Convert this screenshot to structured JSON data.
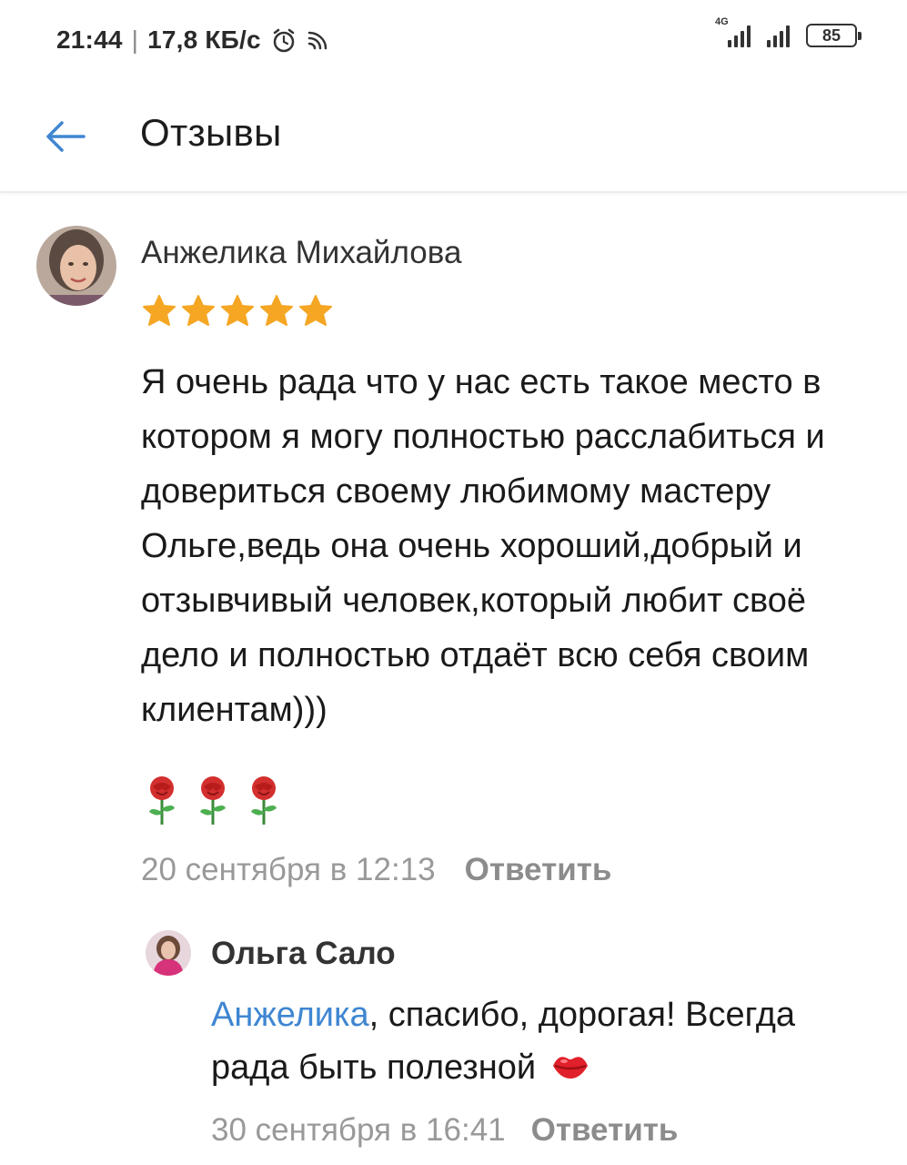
{
  "status_bar": {
    "time": "21:44",
    "speed": "17,8 КБ/с",
    "network_tag": "4G",
    "battery": "85",
    "icons": [
      "alarm-icon",
      "wifi-icon",
      "signal-icon",
      "battery-icon"
    ]
  },
  "app_bar": {
    "title": "Отзывы",
    "back_icon": "arrow-left-icon"
  },
  "review": {
    "author": "Анжелика Михайлова",
    "rating": 5,
    "rating_max": 5,
    "text": "Я очень рада что у нас есть такое место в котором я могу полностью расслабиться и довериться своему любимому мастеру Ольге,ведь она очень хороший,добрый и отзывчивый человек,который любит своё дело и полностью отдаёт всю себя своим клиентам)))",
    "emojis": [
      "rose-icon",
      "rose-icon",
      "rose-icon"
    ],
    "date": "20 сентября в 12:13",
    "reply_label": "Ответить"
  },
  "reply": {
    "author": "Ольга Сало",
    "mention": "Анжелика",
    "text": ", спасибо, дорогая! Всегда рада быть полезной",
    "emoji": "kiss-lips-icon",
    "date": "30 сентября в 16:41",
    "reply_label": "Ответить"
  },
  "colors": {
    "accent": "#3f86d2",
    "star": "#f5a623",
    "muted": "#999999"
  }
}
